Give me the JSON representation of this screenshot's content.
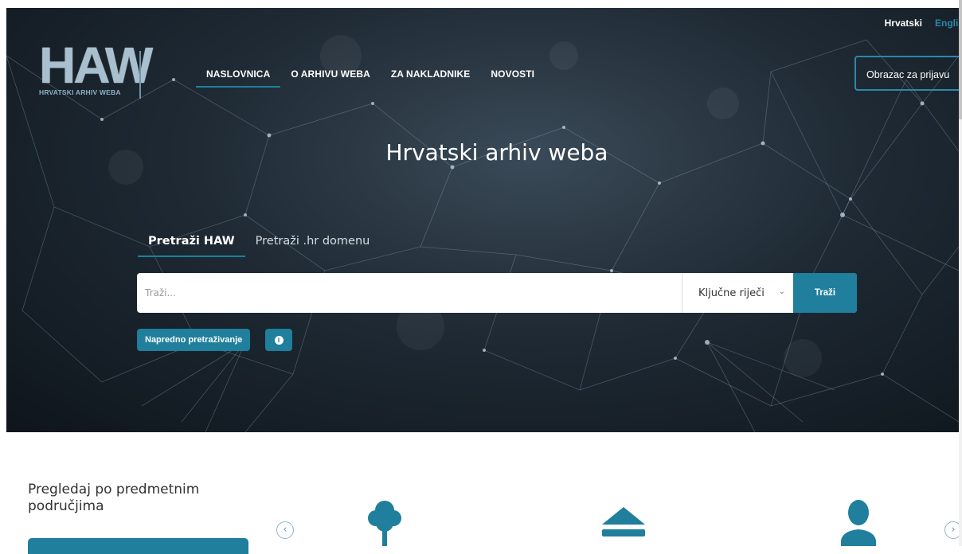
{
  "logo": {
    "big": "HAW",
    "small": "HRVATSKI ARHIV WEBA"
  },
  "nav": [
    {
      "label": "NASLOVNICA",
      "active": true
    },
    {
      "label": "O ARHIVU WEBA"
    },
    {
      "label": "ZA NAKLADNIKE"
    },
    {
      "label": "NOVOSTI"
    }
  ],
  "lang": {
    "current": "Hrvatski",
    "other": "English"
  },
  "obrazac_label": "Obrazac za prijavu",
  "hero_title": "Hrvatski arhiv weba",
  "tabs": [
    {
      "label": "Pretraži HAW",
      "active": true
    },
    {
      "label": "Pretraži .hr domenu"
    }
  ],
  "search": {
    "placeholder": "Traži...",
    "select_value": "Ključne riječi",
    "button_label": "Traži"
  },
  "advanced_label": "Napredno pretraživanje",
  "info_icon": "i",
  "browse": {
    "title_line1": "Pregledaj po predmetnim",
    "title_line2": "područjima"
  },
  "carousel_icons": [
    "tree-icon",
    "eject-icon",
    "person-icon"
  ],
  "colors": {
    "accent": "#1f7f9c",
    "lang_accent": "#2b88aa"
  }
}
